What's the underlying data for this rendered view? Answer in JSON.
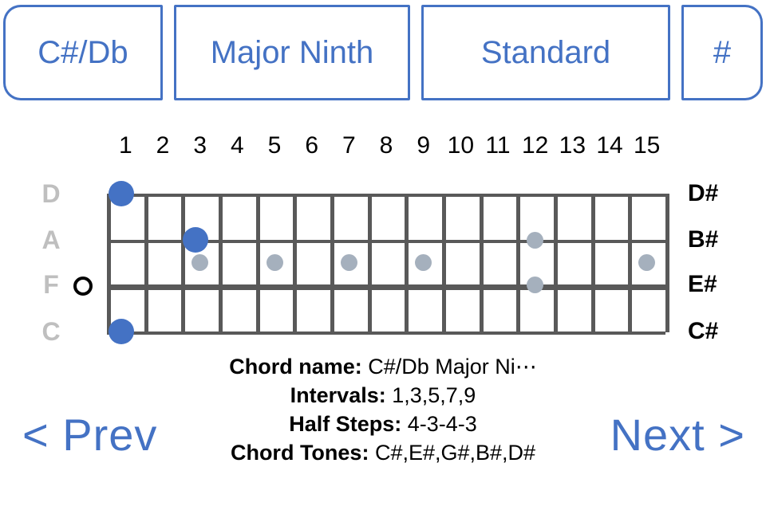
{
  "selectors": {
    "root": "C#/Db",
    "chord_type": "Major Ninth",
    "tuning": "Standard",
    "accidental": "#"
  },
  "fretboard": {
    "fret_numbers": [
      "1",
      "2",
      "3",
      "4",
      "5",
      "6",
      "7",
      "8",
      "9",
      "10",
      "11",
      "12",
      "13",
      "14",
      "15"
    ],
    "string_labels_left": [
      "D",
      "A",
      "F",
      "C"
    ],
    "string_labels_right": [
      "D#",
      "B#",
      "E#",
      "C#"
    ],
    "open_string_marker": {
      "string_index": 2,
      "symbol": "O"
    },
    "chord_tone_dots": [
      {
        "string_index": 0,
        "fret": 1
      },
      {
        "string_index": 1,
        "fret": 3
      },
      {
        "string_index": 3,
        "fret": 1
      }
    ],
    "inlay_dots": [
      {
        "position": "between-1-2",
        "fret": 3
      },
      {
        "position": "between-1-2",
        "fret": 5
      },
      {
        "position": "between-1-2",
        "fret": 7
      },
      {
        "position": "between-1-2",
        "fret": 9
      },
      {
        "position": "on-string-1",
        "fret": 12
      },
      {
        "position": "on-string-2",
        "fret": 12
      },
      {
        "position": "between-1-2",
        "fret": 15
      }
    ],
    "colors": {
      "chord_tone": "#4472C4",
      "inlay": "#A5B0BD",
      "string": "#595959",
      "label_left": "#BFBFBF",
      "label_right": "#000000"
    }
  },
  "info": {
    "rows": [
      {
        "label": "Chord name:",
        "value": "C#/Db Major Ni⋯"
      },
      {
        "label": "Intervals:",
        "value": "1,3,5,7,9"
      },
      {
        "label": "Half Steps:",
        "value": "4-3-4-3"
      },
      {
        "label": "Chord Tones:",
        "value": "C#,E#,G#,B#,D#"
      }
    ]
  },
  "nav": {
    "prev_label": "< Prev",
    "next_label": "Next >",
    "accent": "#4472C4"
  }
}
